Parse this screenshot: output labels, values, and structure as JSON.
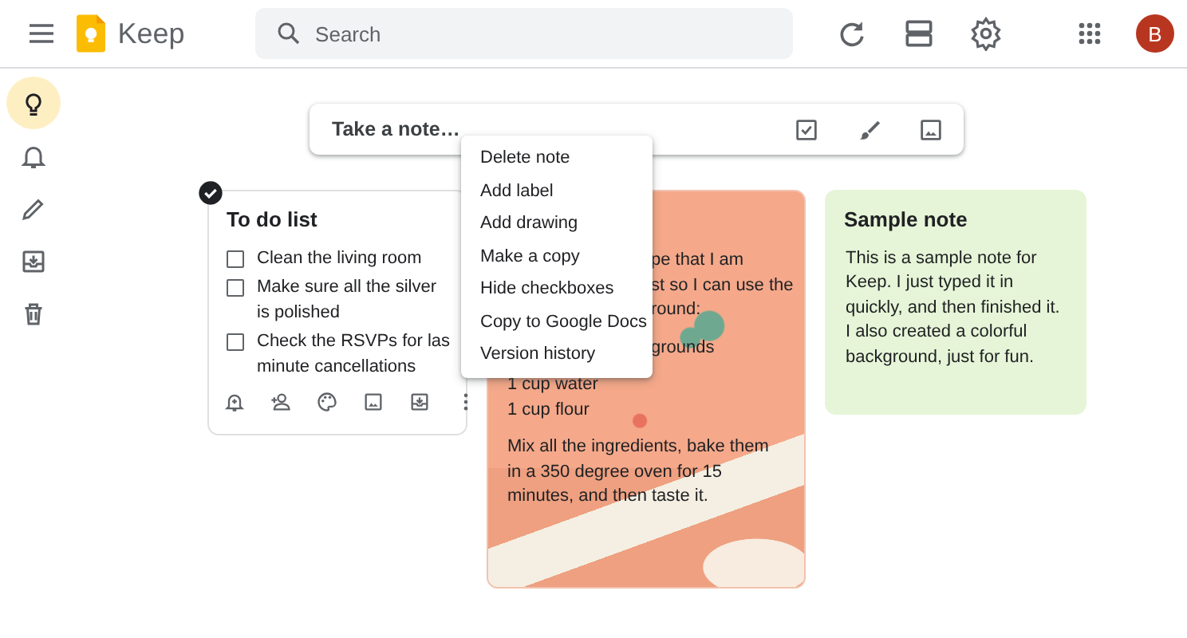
{
  "header": {
    "app_name": "Keep",
    "search": {
      "placeholder": "Search"
    },
    "avatar": {
      "initial": "B"
    }
  },
  "sidebar": {
    "items": [
      {
        "kind": "notes",
        "selected": true
      },
      {
        "kind": "reminders",
        "selected": false
      },
      {
        "kind": "edit",
        "selected": false
      },
      {
        "kind": "archive",
        "selected": false
      },
      {
        "kind": "trash",
        "selected": false
      }
    ]
  },
  "new_note": {
    "placeholder": "Take a note…"
  },
  "notes": [
    {
      "kind": "checklist",
      "title": "To do list",
      "selected": true,
      "color": "#ffffff",
      "items": [
        {
          "lines": [
            "Clean the living room"
          ],
          "checked": false
        },
        {
          "lines": [
            "Make sure all the silver",
            "is polished"
          ],
          "checked": false
        },
        {
          "lines": [
            "Check the RSVPs for las",
            "minute cancellations"
          ],
          "checked": false
        }
      ]
    },
    {
      "kind": "image",
      "paragraphs": [
        [
          {
            "text": "pe that I am",
            "covered": true
          },
          {
            "text": "st so I can use the",
            "covered": true
          },
          {
            "text": "round:",
            "covered": true
          }
        ],
        [
          {
            "text": "grounds",
            "covered": true
          }
        ],
        [
          {
            "text": "1 cup water",
            "covered": false
          },
          {
            "text": "1 cup flour",
            "covered": false
          }
        ],
        [
          {
            "text": "Mix all the ingredients, bake them in a 350 degree oven for 15 minutes, and then taste it.",
            "covered": false
          }
        ]
      ]
    },
    {
      "kind": "text",
      "title": "Sample note",
      "color": "#e6f5d7",
      "body": "This is a sample note for Keep. I just typed it in quickly, and then finished it. I also created a colorful background, just for fun."
    }
  ],
  "context_menu": {
    "items": [
      "Delete note",
      "Add label",
      "Add drawing",
      "Make a copy",
      "Hide checkboxes",
      "Copy to Google Docs",
      "Version history"
    ]
  }
}
